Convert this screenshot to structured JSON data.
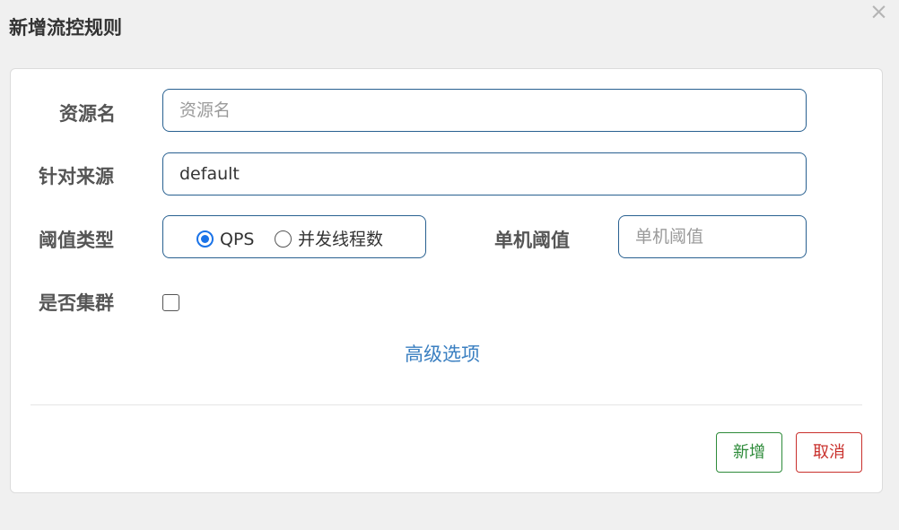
{
  "dialog": {
    "title": "新增流控规则",
    "close_glyph": "×"
  },
  "form": {
    "resource": {
      "label": "资源名",
      "placeholder": "资源名",
      "value": ""
    },
    "origin": {
      "label": "针对来源",
      "value": "default"
    },
    "threshold_type": {
      "label": "阈值类型",
      "options": [
        {
          "label": "QPS",
          "checked": true
        },
        {
          "label": "并发线程数",
          "checked": false
        }
      ]
    },
    "threshold": {
      "label": "单机阈值",
      "placeholder": "单机阈值",
      "value": ""
    },
    "cluster": {
      "label": "是否集群",
      "checked": false
    },
    "advanced_link": "高级选项"
  },
  "footer": {
    "add_label": "新增",
    "cancel_label": "取消"
  },
  "colors": {
    "border_blue": "#286090",
    "link_blue": "#3a7fc1",
    "add_green": "#2e8b3a",
    "cancel_red": "#c9302c",
    "radio_blue": "#1a73e8"
  }
}
